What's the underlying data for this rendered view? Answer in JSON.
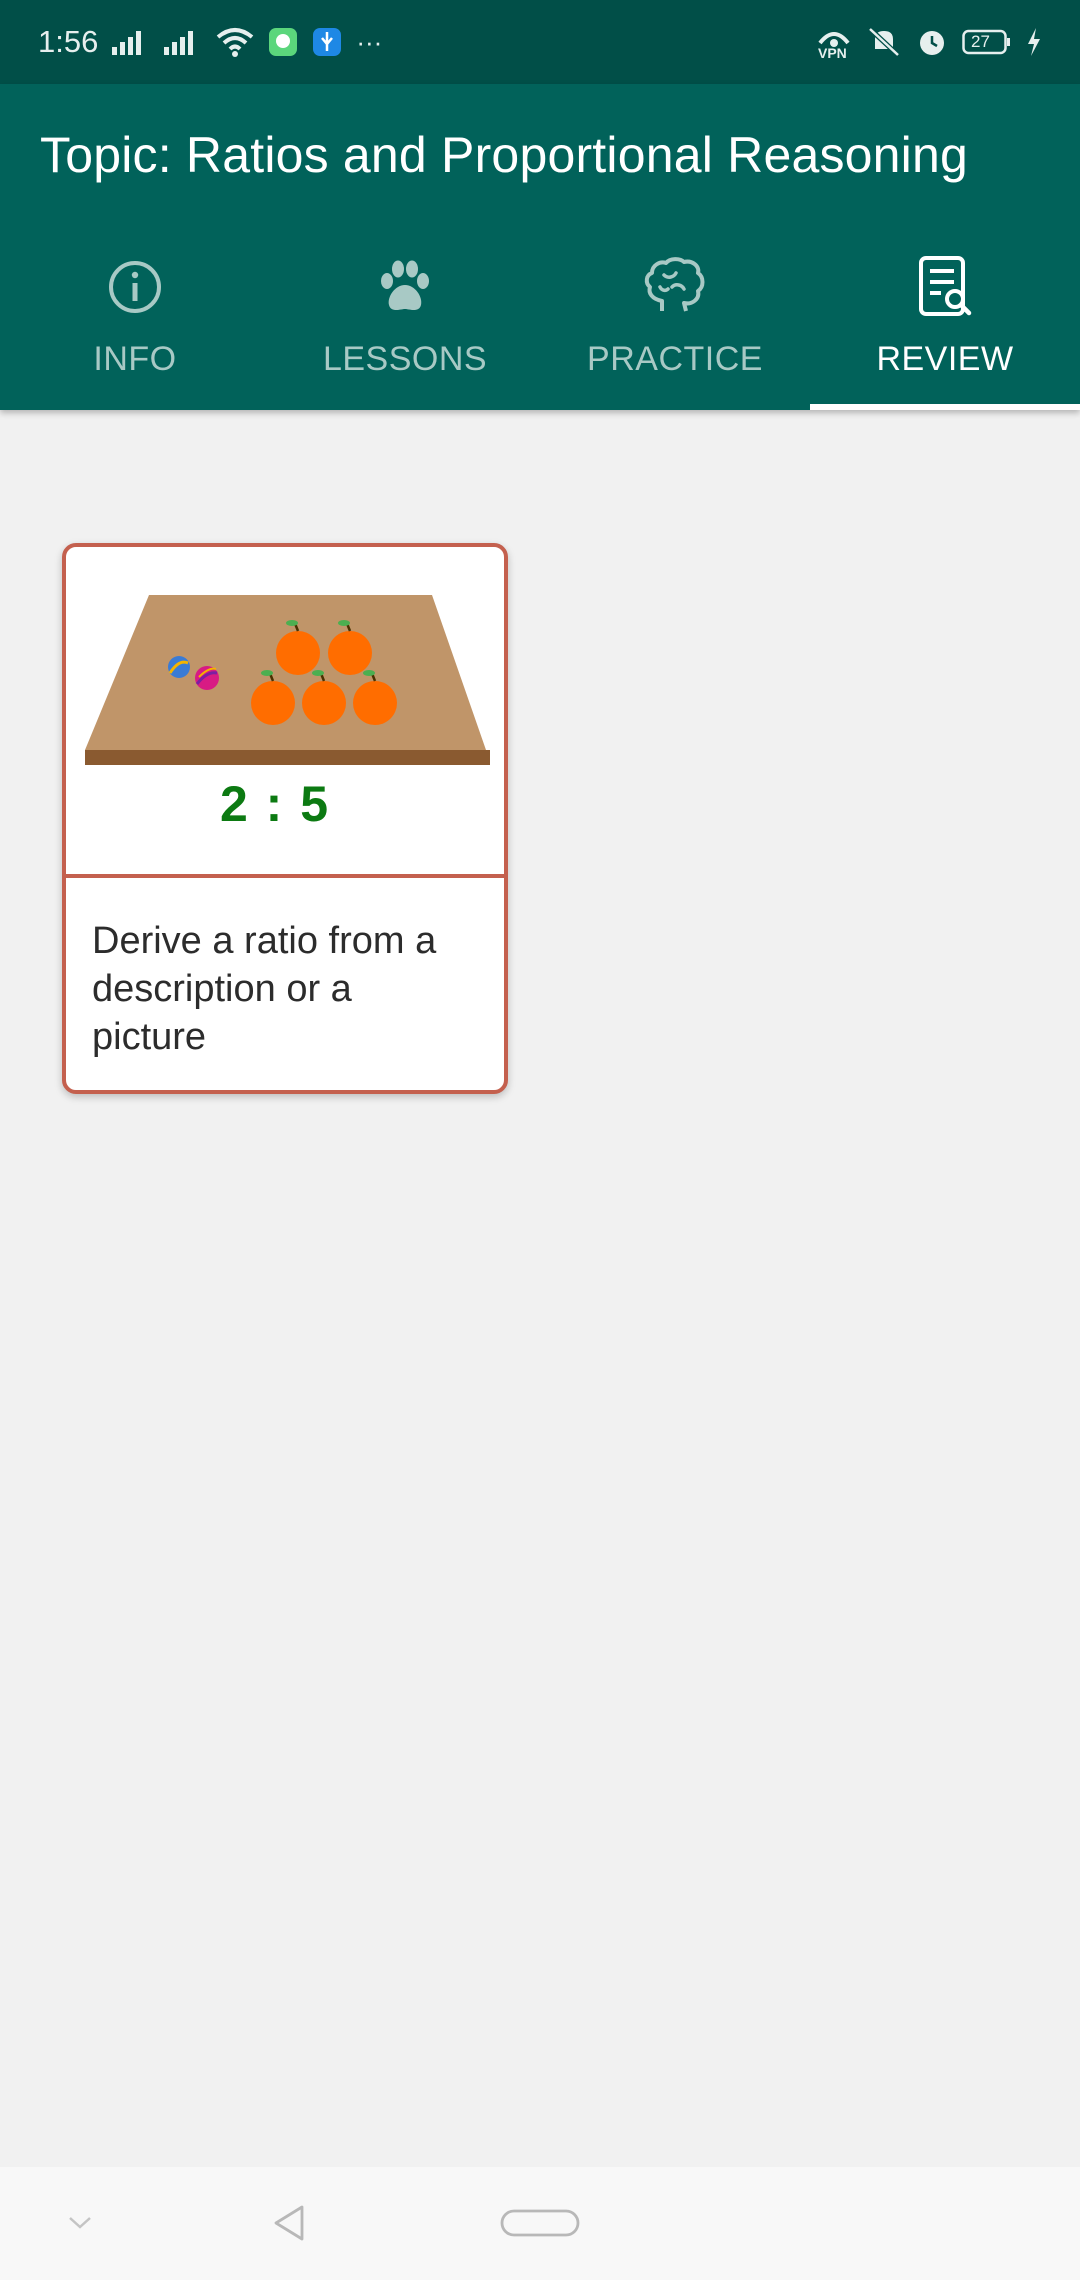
{
  "status_bar": {
    "time": "1:56",
    "overflow_dots": "···",
    "vpn_label": "VPN",
    "battery_level": "27"
  },
  "app_bar": {
    "title": "Topic: Ratios and Proportional Reasoning",
    "tabs": [
      {
        "label": "INFO",
        "icon": "info-icon",
        "active": false
      },
      {
        "label": "LESSONS",
        "icon": "paw-icon",
        "active": false
      },
      {
        "label": "PRACTICE",
        "icon": "brain-icon",
        "active": false
      },
      {
        "label": "REVIEW",
        "icon": "review-document-icon",
        "active": true
      }
    ]
  },
  "review": {
    "cards": [
      {
        "ratio": "2 : 5",
        "caption": "Derive a ratio from a description or a picture",
        "marbles": 2,
        "oranges": 5
      }
    ]
  },
  "colors": {
    "status_bar": "#014f48",
    "app_bar": "#01625a",
    "tab_inactive": "#a8c9c5",
    "card_border": "#c4604e",
    "ratio_text": "#0c7a12",
    "background": "#f1f1f1"
  },
  "nav_bar": {
    "buttons": [
      "collapse-icon",
      "back-icon",
      "home-icon"
    ]
  }
}
